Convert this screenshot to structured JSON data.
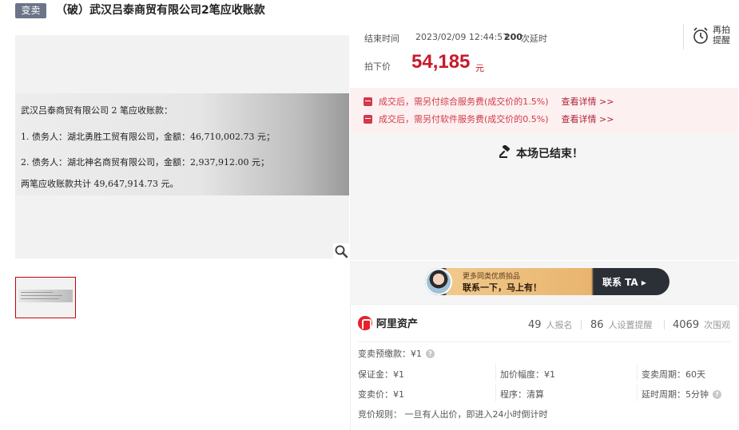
{
  "header": {
    "badge": "变卖",
    "title": "（破）武汉吕泰商贸有限公司2笔应收账款"
  },
  "gallery": {
    "photo_lines": [
      "武汉吕泰商贸有限公司 2 笔应收账款：",
      "1. 债务人：湖北勇胜工贸有限公司，金额：46,710,002.73 元；",
      "2. 债务人：湖北神名商贸有限公司，金额：2,937,912.00 元；",
      "两笔应收账款共计 49,647,914.73 元。"
    ],
    "zoom_icon": "magnifier-icon"
  },
  "auction": {
    "end_label": "结束时间",
    "end_time": "2023/02/09 12:44:57",
    "delay_count": "200",
    "delay_label": "次延时",
    "remind_label": "再拍提醒",
    "price_label": "拍下价",
    "price": "54,185",
    "price_unit": "元",
    "accent_color": "#c7192d"
  },
  "fees": [
    {
      "text": "成交后，需另付综合服务费(成交价的1.5%)",
      "link": "查看详情 >>"
    },
    {
      "text": "成交后，需另付软件服务费(成交价的0.5%)",
      "link": "查看详情 >>"
    }
  ],
  "status": {
    "text": "本场已结束！"
  },
  "contact": {
    "sub": "更多同类优质拍品",
    "main": "联系一下，马上有！",
    "button": "联系 TA ▸"
  },
  "info": {
    "brand": "阿里资产",
    "stats": [
      {
        "num": "49",
        "label": "人报名"
      },
      {
        "num": "86",
        "label": "人设置提醒"
      },
      {
        "num": "4069",
        "label": "次围观"
      }
    ],
    "deposit_pre": "变卖预缴款：¥1",
    "margin": "保证金：¥1",
    "increment": "加价幅度：¥1",
    "period": "变卖周期：60天",
    "price": "变卖价：¥1",
    "procedure": "程序：清算",
    "delay_period": "延时周期：5分钟",
    "rule": "竞价规则：  一旦有人出价，即进入24小时倒计时",
    "help_glyph": "?"
  }
}
